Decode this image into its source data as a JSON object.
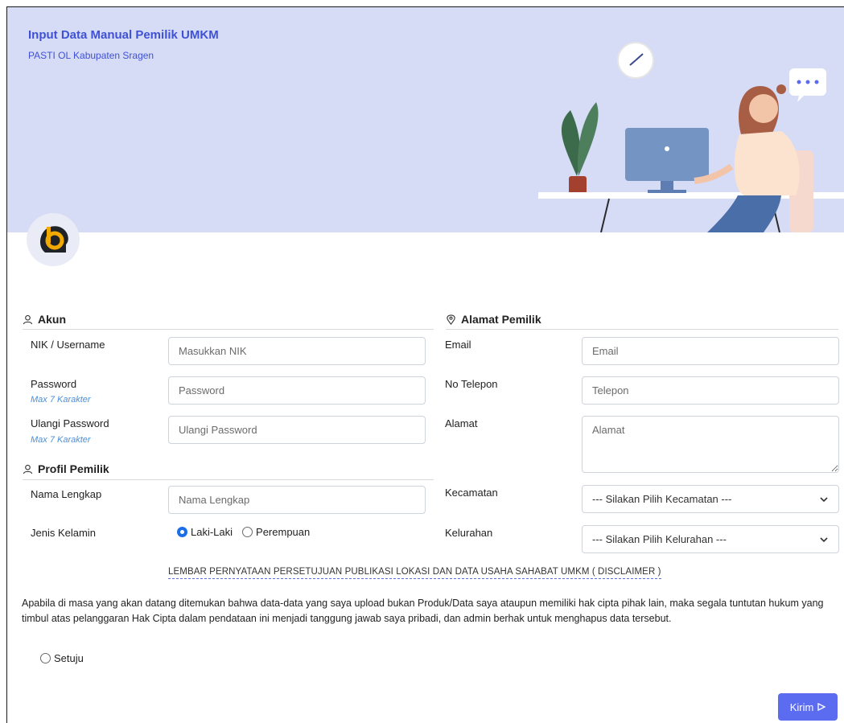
{
  "banner": {
    "title": "Input Data Manual Pemilik UMKM",
    "subtitle": "PASTI OL Kabupaten Sragen"
  },
  "akun": {
    "section_title": "Akun",
    "nik_label": "NIK / Username",
    "nik_placeholder": "Masukkan NIK",
    "password_label": "Password",
    "password_hint": "Max 7 Karakter",
    "password_placeholder": "Password",
    "repeat_label": "Ulangi Password",
    "repeat_hint": "Max 7 Karakter",
    "repeat_placeholder": "Ulangi Password"
  },
  "profil": {
    "section_title": "Profil Pemilik",
    "name_label": "Nama Lengkap",
    "name_placeholder": "Nama Lengkap",
    "gender_label": "Jenis Kelamin",
    "gender_options": [
      "Laki-Laki",
      "Perempuan"
    ],
    "gender_selected": "Laki-Laki"
  },
  "alamat": {
    "section_title": "Alamat Pemilik",
    "email_label": "Email",
    "email_placeholder": "Email",
    "phone_label": "No Telepon",
    "phone_placeholder": "Telepon",
    "address_label": "Alamat",
    "address_placeholder": "Alamat",
    "kecamatan_label": "Kecamatan",
    "kecamatan_value": "--- Silakan Pilih Kecamatan ---",
    "kelurahan_label": "Kelurahan",
    "kelurahan_value": "--- Silakan Pilih Kelurahan ---"
  },
  "disclaimer": {
    "link": "LEMBAR PERNYATAAN PERSETUJUAN PUBLIKASI LOKASI DAN DATA USAHA SAHABAT UMKM ( DISCLAIMER )",
    "text": "Apabila di masa yang akan datang ditemukan bahwa data-data yang saya upload bukan Produk/Data saya ataupun memiliki hak cipta pihak lain, maka segala tuntutan hukum yang timbul atas pelanggaran Hak Cipta dalam pendataan ini menjadi tanggung jawab saya pribadi, dan admin berhak untuk menghapus data tersebut.",
    "agree_label": "Setuju"
  },
  "submit_label": "Kirim",
  "colors": {
    "accent": "#5b6cf0",
    "banner_bg": "#d6dbf6",
    "title": "#3f51d6",
    "hint": "#4a8fd8"
  }
}
